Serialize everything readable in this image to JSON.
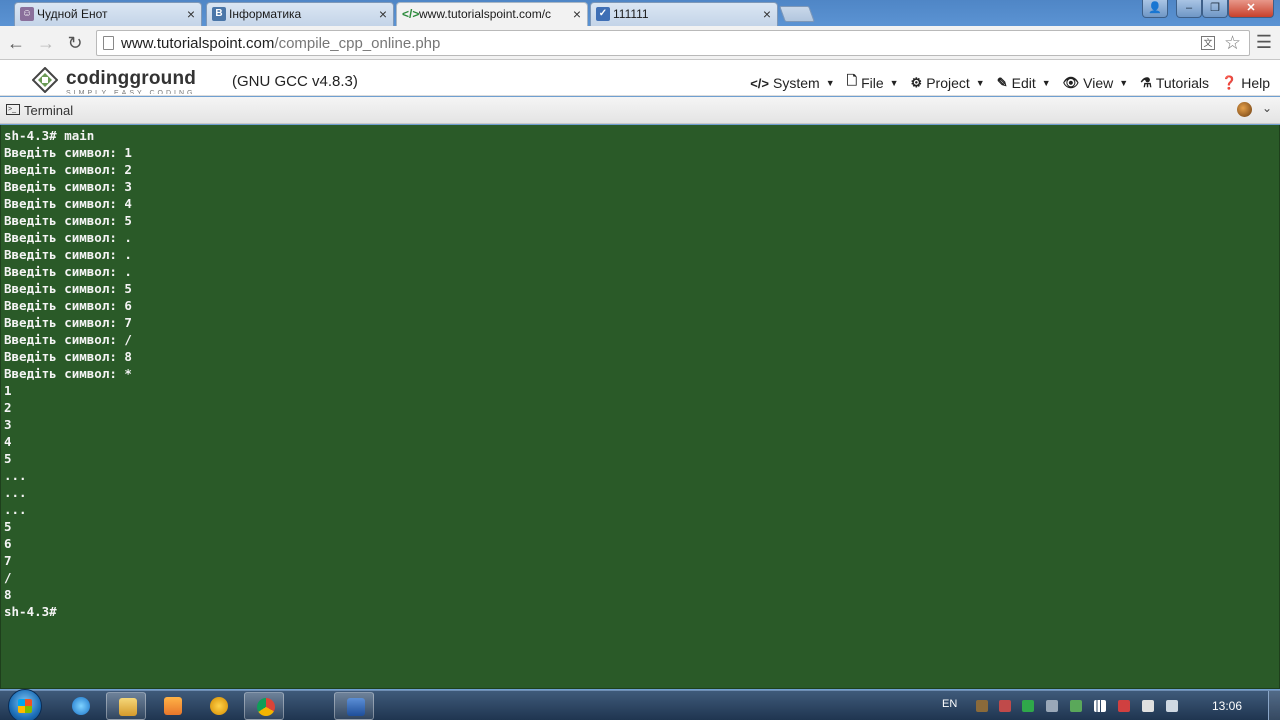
{
  "browser": {
    "tabs": [
      {
        "title": "Чудной Енот",
        "icon": "raccoon-favicon",
        "active": false
      },
      {
        "title": "Інформатика",
        "icon": "vk-favicon",
        "active": false
      },
      {
        "title": "www.tutorialspoint.com/c",
        "icon": "code-favicon",
        "active": true
      },
      {
        "title": "111111",
        "icon": "check-favicon",
        "active": false
      }
    ],
    "tab_close": "×",
    "address": {
      "host": "www.tutorialspoint.com",
      "path": "/compile_cpp_online.php"
    }
  },
  "app": {
    "brand": "codingground",
    "tagline": "SIMPLY EASY CODING",
    "compiler": "(GNU GCC v4.8.3)",
    "menu": [
      {
        "label": "System",
        "icon": "code-icon",
        "dropdown": true
      },
      {
        "label": "File",
        "icon": "file-icon",
        "dropdown": true
      },
      {
        "label": "Project",
        "icon": "gear-icon",
        "dropdown": true
      },
      {
        "label": "Edit",
        "icon": "edit-icon",
        "dropdown": true
      },
      {
        "label": "View",
        "icon": "eye-icon",
        "dropdown": true
      },
      {
        "label": "Tutorials",
        "icon": "tutorials-icon",
        "dropdown": false
      },
      {
        "label": "Help",
        "icon": "help-icon",
        "dropdown": false
      }
    ]
  },
  "terminal": {
    "title": "Terminal",
    "lines": [
      "sh-4.3# main",
      "Введіть символ: 1",
      "Введіть символ: 2",
      "Введіть символ: 3",
      "Введіть символ: 4",
      "Введіть символ: 5",
      "Введіть символ: .",
      "Введіть символ: .",
      "Введіть символ: .",
      "Введіть символ: 5",
      "Введіть символ: 6",
      "Введіть символ: 7",
      "Введіть символ: /",
      "Введіть символ: 8",
      "Введіть символ: *",
      "1",
      "2",
      "3",
      "4",
      "5",
      "...",
      "...",
      "...",
      "5",
      "6",
      "7",
      "/",
      "8",
      "sh-4.3#"
    ],
    "background_color": "#2a5a28"
  },
  "taskbar": {
    "language": "EN",
    "clock": "13:06"
  }
}
